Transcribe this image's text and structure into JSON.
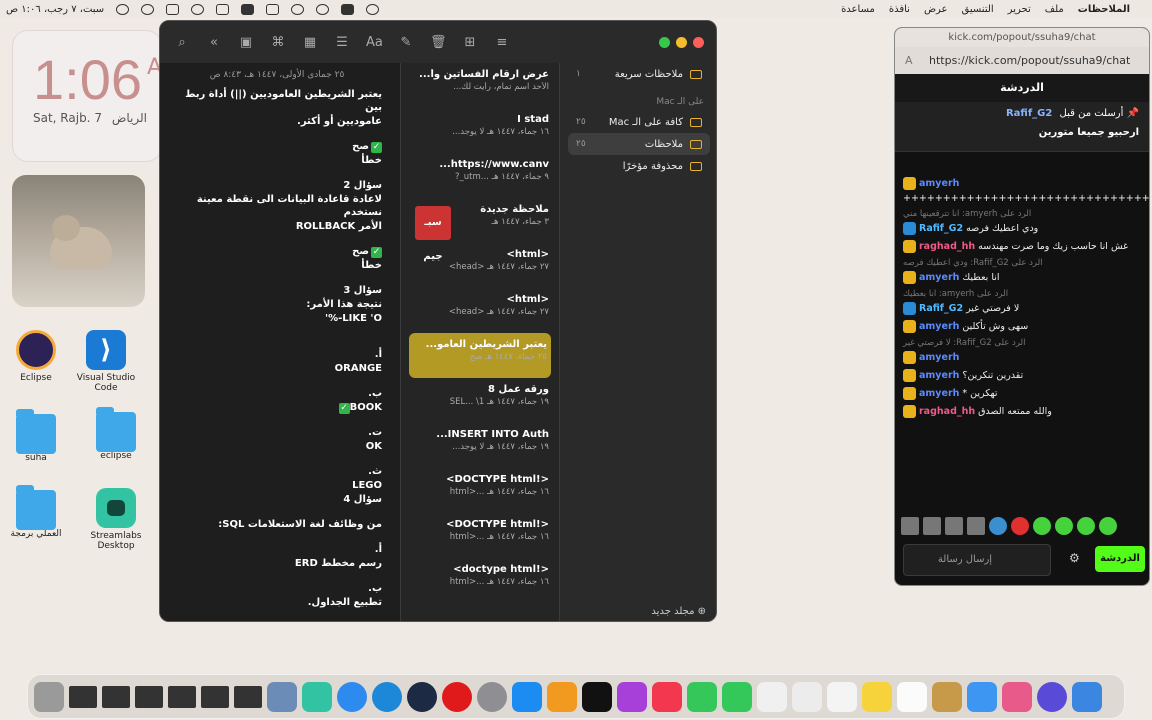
{
  "menubar": {
    "app_name": "الملاحظات",
    "items": [
      "ملف",
      "تحرير",
      "التنسيق",
      "عرض",
      "نافذة",
      "مساعدة"
    ],
    "clock": "سبت، ٧ رجب، ١:٠٦ ص"
  },
  "widget": {
    "time": "1:06",
    "suffix": "A",
    "date": "Sat, Rajb. 7",
    "city": "الرياض"
  },
  "desktop_icons": [
    "Eclipse",
    "Visual Studio Code",
    "suha",
    "eclipse",
    "العملي برمجة",
    "Streamlabs Desktop"
  ],
  "notes_app": {
    "sidebar": {
      "quick_notes": "ملاحظات سريعة",
      "quick_notes_count": "١",
      "section": "على الـ Mac",
      "all_mac": "كافة على الـ Mac",
      "all_mac_count": "٢٥",
      "notes": "ملاحظات",
      "notes_count": "٢٥",
      "recently_deleted": "محذوفة مؤخرًا",
      "new_folder": "مجلد جديد"
    },
    "list": [
      {
        "title": "عرض ارقام الفساتين وأ...",
        "sub": "الأحد   اسم تمام، رأيت لك..."
      },
      {
        "title": "I stad",
        "sub": "١٦ جماء، ١٤٤٧ هـ   لا يوجد..."
      },
      {
        "title": "https://www.canv...",
        "sub": "٩ جماء، ١٤٤٧ هـ   ...utm_?"
      },
      {
        "title": "ملاحظة جديدة",
        "sub": "٣ جماء، ١٤٤٧ هـ"
      },
      {
        "title": "<html>",
        "sub": "٢٧ جماء، ١٤٤٧ هـ   <head>"
      },
      {
        "title": "<html>",
        "sub": "٢٧ جماء، ١٤٤٧ هـ   <head>"
      },
      {
        "title": "يعتبر الشريطين العامو...",
        "sub": "٢٥ جماء، ١٤٤٧ هـ   صح"
      },
      {
        "title": "ورقه عمل 8",
        "sub": "١٩ جماء، ١٤٤٧ هـ   SEL... \\1"
      },
      {
        "title": "INSERT INTO Auth...",
        "sub": "١٩ جماء، ١٤٤٧ هـ   لا يوجد..."
      },
      {
        "title": "<!DOCTYPE html>",
        "sub": "١٦ جماء، ١٤٤٧ هـ   ...<html"
      },
      {
        "title": "<!DOCTYPE html>",
        "sub": "١٦ جماء، ١٤٤٧ هـ   ...<html"
      },
      {
        "title": "<!doctype html>",
        "sub": "١٦ جماء، ١٤٤٧ هـ   ...<html"
      }
    ],
    "thumb_text": "سبـ جيم",
    "editor": {
      "meta": "٢٥ جمادى الأولى، ١٤٤٧ هـ، ٨:٤٣ ص",
      "lines": [
        "يعتبر الشريطين العاموديين (||) أداة ربط بين",
        "عاموديين أو أكثر.",
        "",
        "صح",
        "خطأ",
        "",
        "سؤال 2",
        "لاعادة قاعادة البيانات الى نقطة معينة نستخدم",
        "الأمر ROLLBACK",
        "",
        "صح",
        "خطأ",
        "",
        "سؤال 3",
        "نتيجة هذا الأمر:",
        "LIKE 'O-%'",
        "",
        "",
        "أ.",
        "ORANGE",
        "",
        "ب.",
        "BOOK",
        "",
        "ت.",
        "OK",
        "",
        "ث.",
        "LEGO",
        "سؤال 4",
        "",
        "من وظائف لغة الاستعلامات SQL:",
        "",
        "أ.",
        "رسم مخطط ERD",
        "",
        "ب.",
        "تطبيع الجداول."
      ]
    }
  },
  "kick": {
    "window_title": "kick.com/popout/ssuha9/chat",
    "url": "https://kick.com/popout/ssuha9/chat",
    "header": "الدردشة",
    "pinned_by": "أرسلت من قبل",
    "pinned_user": "Rafif_G2",
    "pinned_message": "ارحبيو جميعا متورين",
    "messages": [
      {
        "reply": "",
        "user": "amyerh",
        "color": "#5b8bff",
        "text": "++++++++++++++++++++++++++++++++++++++++++++++++++++++++++"
      },
      {
        "reply": "الرد على amyerh: انا تترقعينها مني",
        "user": "Rafif_G2",
        "color": "#4fbaff",
        "text": "ودي اعطيك فرصه"
      },
      {
        "reply": "",
        "user": "raghad_hh",
        "color": "#f05a88",
        "text": "غش انا حاسب زيك وما صرت مهندسه"
      },
      {
        "reply": "الرد على Rafif_G2: ودي اعطيك فرصه",
        "user": "amyerh",
        "color": "#5b8bff",
        "text": "انا بعطيك"
      },
      {
        "reply": "الرد على amyerh: انا بعطيك",
        "user": "Rafif_G2",
        "color": "#4fbaff",
        "text": "لا فرصتي غير"
      },
      {
        "reply": "",
        "user": "amyerh",
        "color": "#5b8bff",
        "text": "سهى وش تأكلين"
      },
      {
        "reply": "الرد على Rafif_G2: لا فرصتي غير",
        "user": "amyerh",
        "color": "#5b8bff",
        "text": ""
      },
      {
        "reply": "",
        "user": "amyerh",
        "color": "#5b8bff",
        "text": "تقدرين تنكرين؟"
      },
      {
        "reply": "",
        "user": "amyerh",
        "color": "#5b8bff",
        "text": "تهكرين *"
      },
      {
        "reply": "",
        "user": "raghad_hh",
        "color": "#f05a88",
        "text": "والله ممتعه الصدق"
      }
    ],
    "input_placeholder": "إرسال رسالة",
    "send_label": "الدردشة"
  },
  "colors": {
    "notes_selected": "#b39a25",
    "kick_green": "#53fc18",
    "folder_yellow": "#e7b22e"
  }
}
